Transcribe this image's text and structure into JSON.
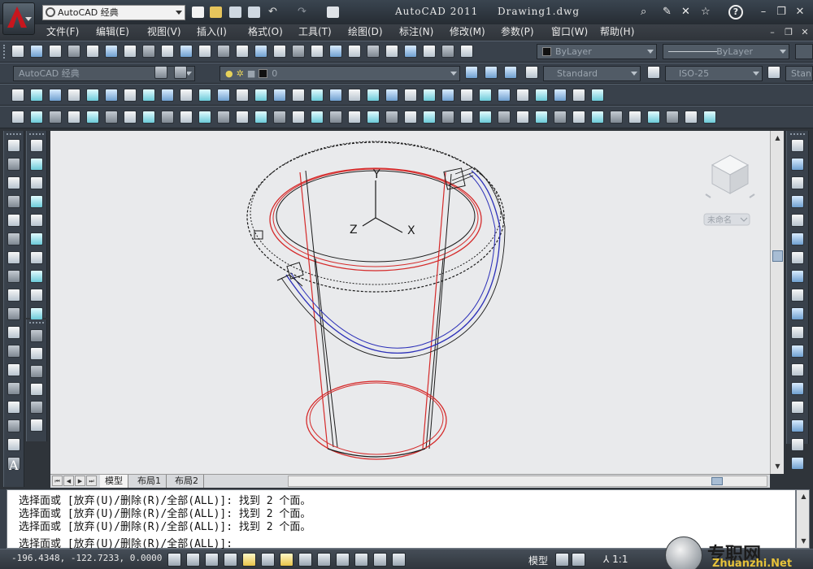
{
  "title_bar": {
    "workspace": "AutoCAD 经典",
    "app_title": "AutoCAD 2011",
    "doc_title": "Drawing1.dwg",
    "help_label": "?"
  },
  "menu": {
    "items": [
      "文件(F)",
      "编辑(E)",
      "视图(V)",
      "插入(I)",
      "格式(O)",
      "工具(T)",
      "绘图(D)",
      "标注(N)",
      "修改(M)",
      "参数(P)",
      "窗口(W)",
      "帮助(H)"
    ]
  },
  "toolbars": {
    "color_combo": "ByLayer",
    "linetype_combo": "ByLayer",
    "workspace_combo": "AutoCAD 经典",
    "layer_combo": "0",
    "text_style_combo": "Standard",
    "dim_style_combo": "ISO-25",
    "table_style_combo": "Stan"
  },
  "viewcube": {
    "unnamed_label": "未命名"
  },
  "canvas": {
    "ucs": {
      "x": "X",
      "y": "Y",
      "z": "Z"
    }
  },
  "tabs": [
    "模型",
    "布局1",
    "布局2"
  ],
  "command_history": [
    "选择面或 [放弃(U)/删除(R)/全部(ALL)]: 找到 2 个面。",
    "选择面或 [放弃(U)/删除(R)/全部(ALL)]: 找到 2 个面。",
    "选择面或 [放弃(U)/删除(R)/全部(ALL)]: 找到 2 个面。"
  ],
  "command_prompt": "选择面或 [放弃(U)/删除(R)/全部(ALL)]:",
  "status_bar": {
    "coordinates": "-196.4348, -122.7233, 0.0000",
    "model_label": "模型",
    "annotation_scale": "1:1"
  },
  "watermark": {
    "text_cn": "专职网",
    "text_en": "Zhuanzhi.Net"
  },
  "colors": {
    "canvas": "#e9eaec",
    "red_wire": "#d52a2a",
    "blue_wire": "#2b2fb8",
    "black_wire": "#1a1a1a"
  }
}
